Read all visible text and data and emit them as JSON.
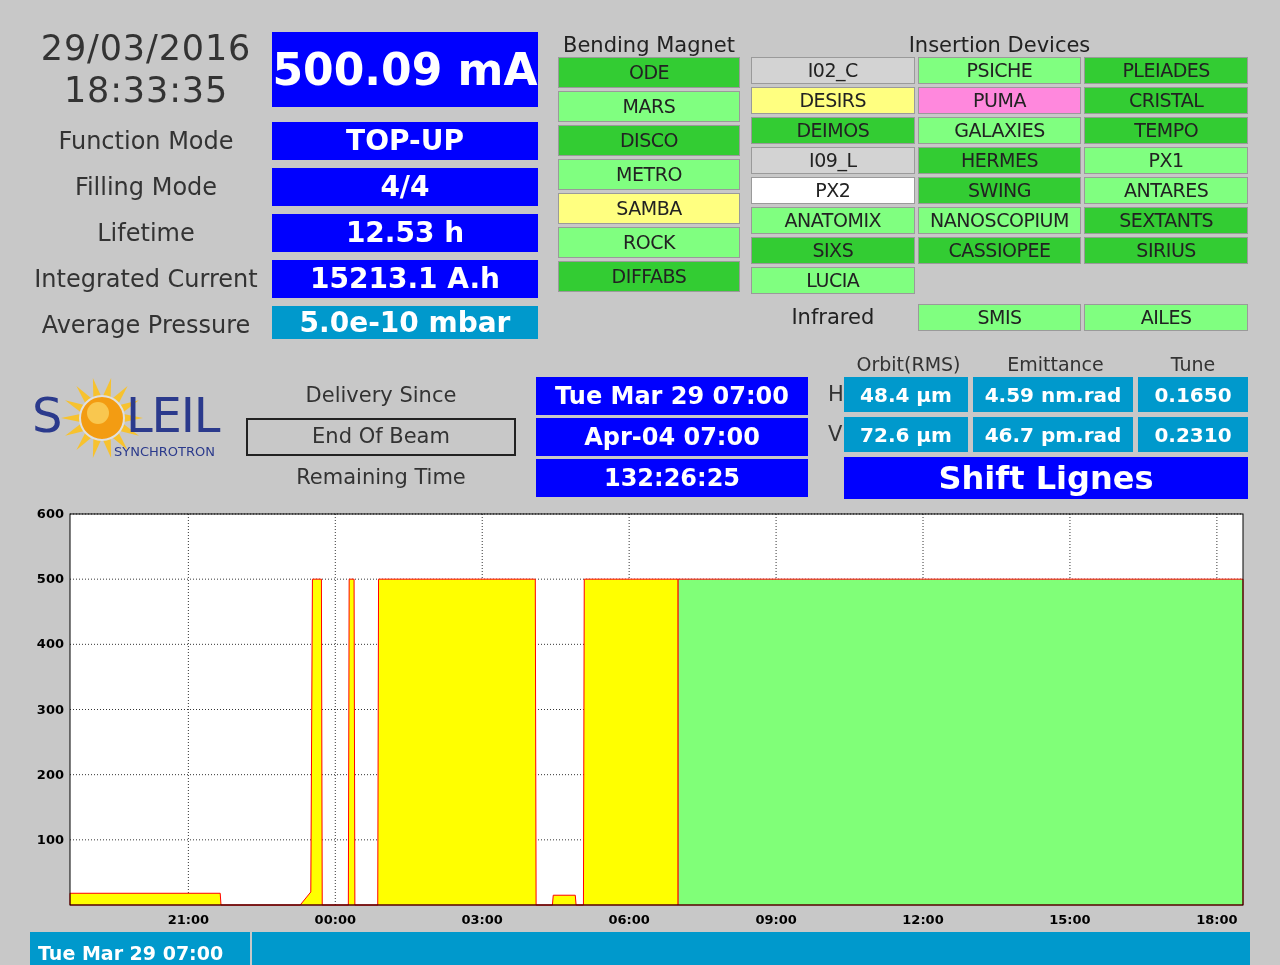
{
  "clock": {
    "date": "29/03/2016",
    "time": "18:33:35"
  },
  "beam_current": "500.09 mA",
  "parameters": [
    {
      "label": "Function Mode",
      "value": "TOP-UP",
      "kind": "status"
    },
    {
      "label": "Filling Mode",
      "value": "4/4",
      "kind": "status"
    },
    {
      "label": "Lifetime",
      "value": "12.53 h",
      "kind": "status"
    },
    {
      "label": "Integrated Current",
      "value": "15213.1 A.h",
      "kind": "status"
    },
    {
      "label": "Average Pressure",
      "value": "5.0e-10 mbar",
      "kind": "measure"
    }
  ],
  "bending_magnet": {
    "title": "Bending Magnet",
    "beamlines": [
      {
        "name": "ODE",
        "color": "#33cc33"
      },
      {
        "name": "MARS",
        "color": "#80ff80"
      },
      {
        "name": "DISCO",
        "color": "#33cc33"
      },
      {
        "name": "METRO",
        "color": "#80ff80"
      },
      {
        "name": "SAMBA",
        "color": "#ffff80"
      },
      {
        "name": "ROCK",
        "color": "#80ff80"
      },
      {
        "name": "DIFFABS",
        "color": "#33cc33"
      }
    ]
  },
  "insertion_devices": {
    "title": "Insertion Devices",
    "beamlines": [
      {
        "name": "I02_C",
        "color": "#d3d3d3"
      },
      {
        "name": "PSICHE",
        "color": "#80ff80"
      },
      {
        "name": "PLEIADES",
        "color": "#33cc33"
      },
      {
        "name": "DESIRS",
        "color": "#ffff80"
      },
      {
        "name": "PUMA",
        "color": "#ff88dd"
      },
      {
        "name": "CRISTAL",
        "color": "#33cc33"
      },
      {
        "name": "DEIMOS",
        "color": "#33cc33"
      },
      {
        "name": "GALAXIES",
        "color": "#80ff80"
      },
      {
        "name": "TEMPO",
        "color": "#33cc33"
      },
      {
        "name": "I09_L",
        "color": "#d3d3d3"
      },
      {
        "name": "HERMES",
        "color": "#33cc33"
      },
      {
        "name": "PX1",
        "color": "#80ff80"
      },
      {
        "name": "PX2",
        "color": "#ffffff"
      },
      {
        "name": "SWING",
        "color": "#33cc33"
      },
      {
        "name": "ANTARES",
        "color": "#80ff80"
      },
      {
        "name": "ANATOMIX",
        "color": "#80ff80"
      },
      {
        "name": "NANOSCOPIUM",
        "color": "#80ff80"
      },
      {
        "name": "SEXTANTS",
        "color": "#33cc33"
      },
      {
        "name": "SIXS",
        "color": "#33cc33"
      },
      {
        "name": "CASSIOPEE",
        "color": "#33cc33"
      },
      {
        "name": "SIRIUS",
        "color": "#33cc33"
      },
      {
        "name": "LUCIA",
        "color": "#80ff80"
      }
    ]
  },
  "infrared": {
    "label": "Infrared",
    "beamlines": [
      {
        "name": "SMIS",
        "color": "#80ff80"
      },
      {
        "name": "AILES",
        "color": "#80ff80"
      }
    ]
  },
  "logo": {
    "lead": "S",
    "tail": "LEIL",
    "subtitle": "SYNCHROTRON"
  },
  "delivery": [
    {
      "label": "Delivery Since",
      "value": "Tue Mar 29 07:00",
      "framed": false
    },
    {
      "label": "End Of Beam",
      "value": "Apr-04 07:00",
      "framed": true
    },
    {
      "label": "Remaining Time",
      "value": "132:26:25",
      "framed": false
    }
  ],
  "beam_parameters": {
    "columns": [
      "Orbit(RMS)",
      "Emittance",
      "Tune"
    ],
    "rows": [
      {
        "plane": "H",
        "values": [
          "48.4 µm",
          "4.59 nm.rad",
          "0.1650"
        ]
      },
      {
        "plane": "V",
        "values": [
          "72.6 µm",
          "46.7 pm.rad",
          "0.2310"
        ]
      }
    ]
  },
  "shift": "Shift Lignes",
  "chart_data": {
    "type": "area",
    "grid": true,
    "xlim": [
      "2016-03-28T18:35",
      "2016-03-29T18:32"
    ],
    "ylim": [
      0,
      600
    ],
    "yticks": [
      100,
      200,
      300,
      400,
      500,
      600
    ],
    "xticks": [
      {
        "value": "2016-03-28T21:00",
        "label": "21:00"
      },
      {
        "value": "2016-03-29T00:00",
        "label": "00:00"
      },
      {
        "value": "2016-03-29T03:00",
        "label": "03:00"
      },
      {
        "value": "2016-03-29T06:00",
        "label": "06:00"
      },
      {
        "value": "2016-03-29T09:00",
        "label": "09:00"
      },
      {
        "value": "2016-03-29T12:00",
        "label": "12:00"
      },
      {
        "value": "2016-03-29T15:00",
        "label": "15:00"
      },
      {
        "value": "2016-03-29T18:00",
        "label": "18:00"
      }
    ],
    "x": [
      "2016-03-28T18:35",
      "2016-03-28T21:39",
      "2016-03-28T21:40",
      "2016-03-28T23:17",
      "2016-03-28T23:30",
      "2016-03-28T23:32",
      "2016-03-28T23:43",
      "2016-03-28T23:44",
      "2016-03-29T00:16",
      "2016-03-29T00:17",
      "2016-03-29T00:23",
      "2016-03-29T00:24",
      "2016-03-29T00:52",
      "2016-03-29T00:53",
      "2016-03-29T04:05",
      "2016-03-29T04:06",
      "2016-03-29T04:26",
      "2016-03-29T04:27",
      "2016-03-29T04:54",
      "2016-03-29T04:55",
      "2016-03-29T05:04",
      "2016-03-29T05:05",
      "2016-03-29T07:00",
      "2016-03-29T18:32"
    ],
    "series": [
      {
        "color": "#ffff00",
        "values": [
          18,
          18,
          0,
          0,
          20,
          500,
          500,
          0,
          0,
          500,
          500,
          0,
          0,
          500,
          500,
          0,
          0,
          15,
          15,
          0,
          0,
          500,
          500,
          null
        ]
      },
      {
        "color": "#80ff78",
        "values": [
          null,
          null,
          null,
          null,
          null,
          null,
          null,
          null,
          null,
          null,
          null,
          null,
          null,
          null,
          null,
          null,
          null,
          null,
          null,
          null,
          null,
          null,
          500,
          500
        ]
      }
    ]
  },
  "footer": {
    "date": "Tue Mar 29 07:00"
  }
}
